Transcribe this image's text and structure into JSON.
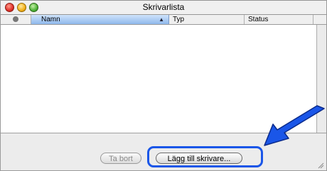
{
  "window": {
    "title": "Skrivarlista"
  },
  "table": {
    "columns": [
      "Namn",
      "Typ",
      "Status"
    ],
    "sort_indicator": "▲",
    "rows": []
  },
  "buttons": {
    "remove_label": "Ta bort",
    "add_label": "Lägg till skrivare..."
  },
  "colors": {
    "highlight": "#1a56e8",
    "arrow": "#1a56e8"
  },
  "icons": [
    "window-close-icon",
    "window-minimize-icon",
    "window-zoom-icon",
    "status-dot-icon",
    "sort-ascending-icon",
    "resize-grip-icon",
    "callout-arrow-icon"
  ]
}
